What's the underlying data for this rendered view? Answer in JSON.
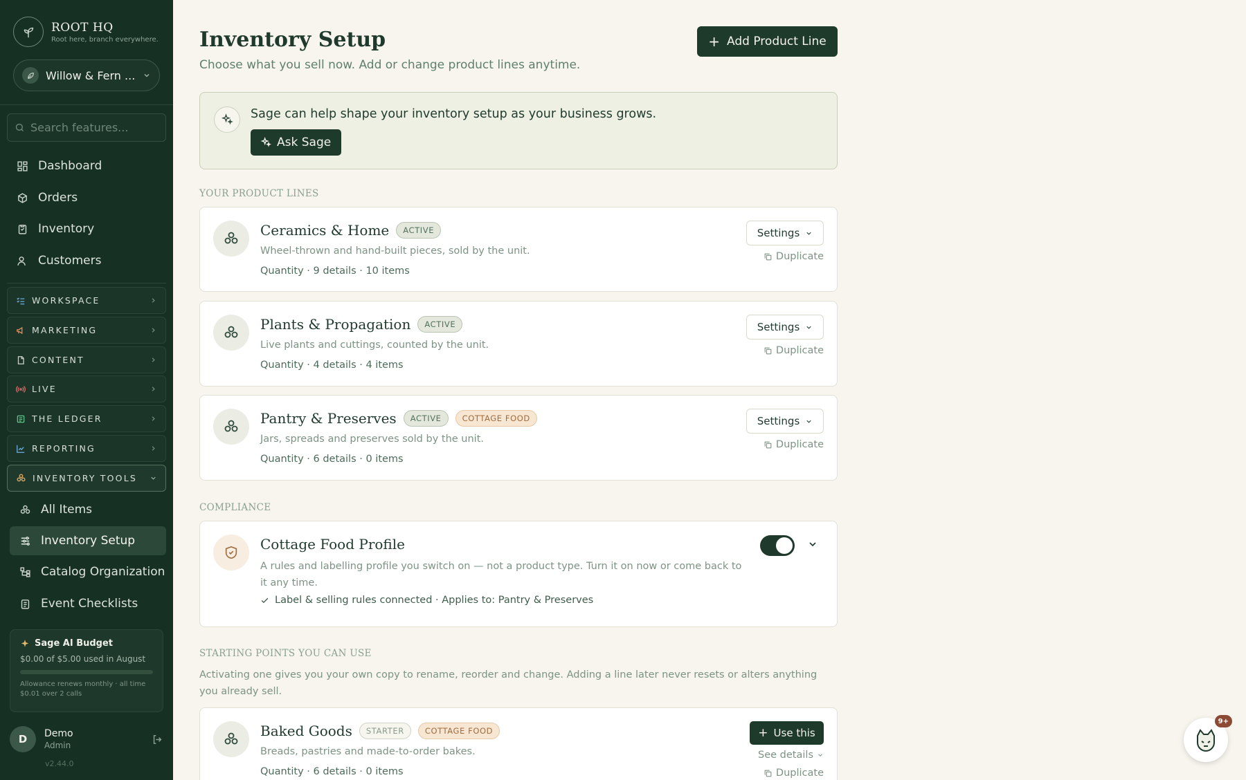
{
  "brand": {
    "name": "ROOT HQ",
    "tagline": "Root here, branch everywhere."
  },
  "store": {
    "name": "Willow & Fern ..."
  },
  "search": {
    "placeholder": "Search features..."
  },
  "nav": [
    {
      "label": "Dashboard",
      "icon": "grid-icon"
    },
    {
      "label": "Orders",
      "icon": "box-icon"
    },
    {
      "label": "Inventory",
      "icon": "clipboard-icon"
    },
    {
      "label": "Customers",
      "icon": "users-icon"
    }
  ],
  "groups": [
    {
      "label": "WORKSPACE",
      "icon": "checklist-icon"
    },
    {
      "label": "MARKETING",
      "icon": "megaphone-icon"
    },
    {
      "label": "CONTENT",
      "icon": "document-icon"
    },
    {
      "label": "LIVE",
      "icon": "broadcast-icon"
    },
    {
      "label": "THE LEDGER",
      "icon": "ledger-icon"
    },
    {
      "label": "REPORTING",
      "icon": "chart-icon"
    },
    {
      "label": "INVENTORY TOOLS",
      "icon": "stack-icon"
    }
  ],
  "subnav": [
    {
      "label": "All Items",
      "icon": "stack-icon"
    },
    {
      "label": "Inventory Setup",
      "icon": "sliders-icon"
    },
    {
      "label": "Catalog Organization",
      "icon": "tree-icon"
    },
    {
      "label": "Event Checklists",
      "icon": "checklist-icon"
    }
  ],
  "budget": {
    "title": "Sage AI Budget",
    "used": "$0.00 of $5.00 used in August",
    "progress": 0.0,
    "note": "Allowance renews monthly · all time $0.01 over 2 calls"
  },
  "user": {
    "initial": "D",
    "name": "Demo",
    "role": "Admin",
    "version": "v2.44.0"
  },
  "header": {
    "title": "Inventory Setup",
    "subtitle": "Choose what you sell now. Add or change product lines anytime.",
    "add_button": "Add Product Line"
  },
  "sage": {
    "message": "Sage can help shape your inventory setup as your business grows.",
    "button": "Ask Sage"
  },
  "sections": {
    "product_lines": "YOUR PRODUCT LINES",
    "compliance": "COMPLIANCE",
    "starting": "STARTING POINTS YOU CAN USE",
    "starting_desc": "Activating one gives you your own copy to rename, reorder and change. Adding a line later never resets or alters anything you already sell."
  },
  "product_lines": [
    {
      "title": "Ceramics & Home",
      "badges": [
        "ACTIVE"
      ],
      "desc": "Wheel-thrown and hand-built pieces, sold by the unit.",
      "meta": "Quantity · 9 details · 10 items"
    },
    {
      "title": "Plants & Propagation",
      "badges": [
        "ACTIVE"
      ],
      "desc": "Live plants and cuttings, counted by the unit.",
      "meta": "Quantity · 4 details · 4 items"
    },
    {
      "title": "Pantry & Preserves",
      "badges": [
        "ACTIVE",
        "COTTAGE FOOD"
      ],
      "desc": "Jars, spreads and preserves sold by the unit.",
      "meta": "Quantity · 6 details · 0 items"
    }
  ],
  "actions": {
    "settings": "Settings",
    "duplicate": "Duplicate",
    "use_this": "Use this",
    "see_details": "See details"
  },
  "compliance": {
    "title": "Cottage Food Profile",
    "desc": "A rules and labelling profile you switch on — not a product type. Turn it on now or come back to it any time.",
    "check": "Label & selling rules connected · Applies to: Pantry & Preserves",
    "enabled": true
  },
  "starting_points": [
    {
      "title": "Baked Goods",
      "badges": [
        "STARTER",
        "COTTAGE FOOD"
      ],
      "desc": "Breads, pastries and made-to-order bakes.",
      "meta": "Quantity · 6 details · 0 items"
    }
  ],
  "chat": {
    "badge": "9+"
  },
  "colors": {
    "sidebar": "#173024",
    "primary": "#1e3a2b",
    "background": "#f7f5ee",
    "accent": "#c8a970"
  }
}
